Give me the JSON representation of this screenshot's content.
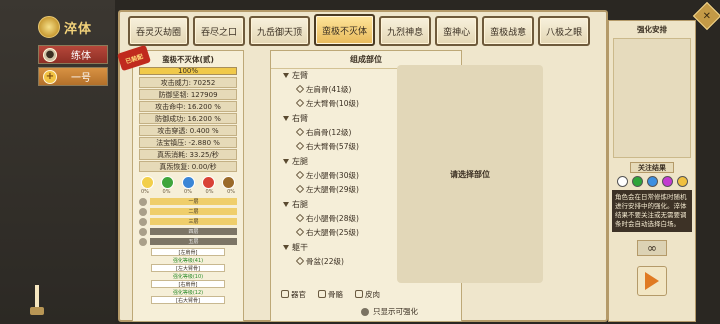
{
  "sidebar": {
    "title": "淬体",
    "items": [
      {
        "label": "练体",
        "icon": "person-icon"
      },
      {
        "label": "一号",
        "icon": "plus-icon"
      }
    ]
  },
  "tabs": [
    "吞灵灭劫圈",
    "吞尽之口",
    "九岳御天顶",
    "蛮极不灭体",
    "九烈神息",
    "蛮神心",
    "蛮极战意",
    "八极之眼"
  ],
  "active_tab": 3,
  "card": {
    "title": "蛮极不灭体(贰)",
    "seal": "已装配",
    "progress_text": "100%",
    "progress": 1.0,
    "stats": [
      {
        "k": "攻击威力:",
        "v": "70252"
      },
      {
        "k": "防御坚韧:",
        "v": "127909"
      },
      {
        "k": "攻击命中:",
        "v": "16.200 %"
      },
      {
        "k": "防御成功:",
        "v": "16.200 %"
      },
      {
        "k": "攻击穿透:",
        "v": "0.400 %"
      },
      {
        "k": "法宝镇压:",
        "v": "-2.880 %"
      },
      {
        "k": "真炁消耗:",
        "v": "33.25/秒"
      },
      {
        "k": "真炁恢复:",
        "v": "0.00/秒"
      }
    ],
    "elements": [
      {
        "name": "metal",
        "color": "#f2cf4a",
        "v": "0%"
      },
      {
        "name": "wood",
        "color": "#3fa53c",
        "v": "0%"
      },
      {
        "name": "water",
        "color": "#3b86d6",
        "v": "0%"
      },
      {
        "name": "fire",
        "color": "#d94236",
        "v": "0%"
      },
      {
        "name": "earth",
        "color": "#9a6a2a",
        "v": "0%"
      }
    ],
    "slots": [
      "一层",
      "二层",
      "三层",
      "四层",
      "五层"
    ],
    "parts": [
      {
        "label": "[左肩骨]",
        "sub": ""
      },
      {
        "label": "",
        "sub": "强化等级(41)"
      },
      {
        "label": "[左大臂骨]",
        "sub": ""
      },
      {
        "label": "",
        "sub": "强化等级(10)"
      },
      {
        "label": "[右肩骨]",
        "sub": ""
      },
      {
        "label": "",
        "sub": "强化等级(12)"
      },
      {
        "label": "[右大臂骨]",
        "sub": ""
      }
    ]
  },
  "mid": {
    "title": "组成部位",
    "tree": [
      {
        "group": "左臂",
        "open": true,
        "leaves": [
          "左肩骨(41级)",
          "左大臂骨(10级)"
        ]
      },
      {
        "group": "右臂",
        "open": true,
        "leaves": [
          "右肩骨(12级)",
          "右大臂骨(57级)"
        ]
      },
      {
        "group": "左腿",
        "open": true,
        "leaves": [
          "左小腿骨(30级)",
          "左大腿骨(29级)"
        ]
      },
      {
        "group": "右腿",
        "open": true,
        "leaves": [
          "右小腿骨(28级)",
          "右大腿骨(25级)"
        ]
      },
      {
        "group": "躯干",
        "open": true,
        "leaves": [
          "骨盆(22级)"
        ]
      }
    ],
    "placeholder": "请选择部位",
    "footer": [
      "器官",
      "骨骼",
      "皮肉"
    ],
    "only_show": "只显示可强化"
  },
  "right": {
    "title": "强化安排",
    "focus_label": "关注结果",
    "focus_colors": [
      "#ffffff",
      "#2ea43a",
      "#3c8fe0",
      "#c23bd0",
      "#f0c040"
    ],
    "desc": "角色会在日常修炼时随机进行安排中的强化。淬体结果不要关注或无需要调条时会自动选择白场。",
    "inf_symbol": "∞"
  }
}
